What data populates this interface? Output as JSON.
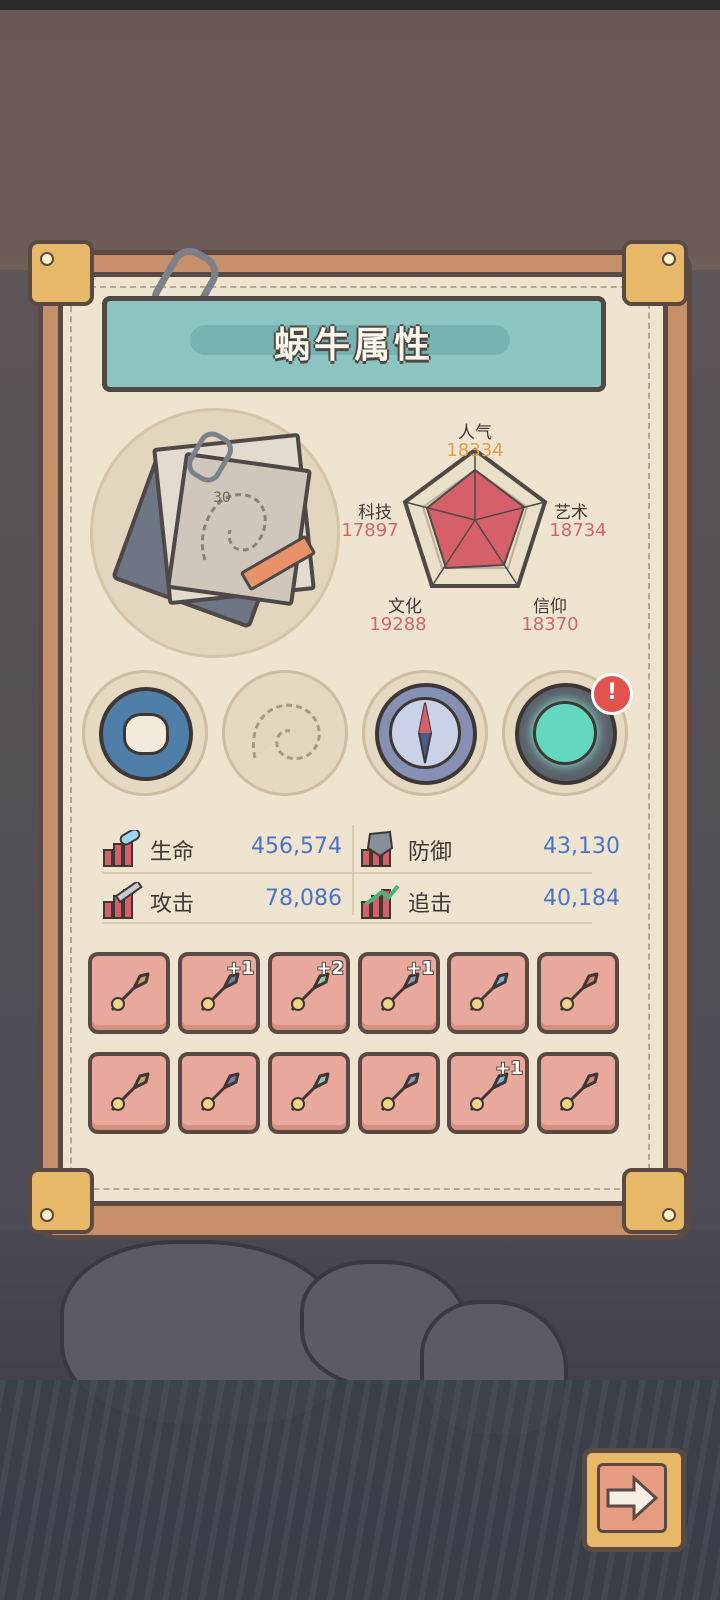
{
  "panel": {
    "title": "蜗牛属性"
  },
  "radar": {
    "stats": [
      {
        "name": "人气",
        "value": "18334"
      },
      {
        "name": "艺术",
        "value": "18734"
      },
      {
        "name": "信仰",
        "value": "18370"
      },
      {
        "name": "文化",
        "value": "19288"
      },
      {
        "name": "科技",
        "value": "17897"
      }
    ]
  },
  "medallions": [
    {
      "icon": "chomper-fish-icon",
      "notify": false
    },
    {
      "icon": "snail-shell-icon",
      "notify": false
    },
    {
      "icon": "compass-icon",
      "notify": false
    },
    {
      "icon": "portal-orb-icon",
      "notify": true,
      "badge": "!"
    }
  ],
  "attributes": [
    {
      "label": "生命",
      "value": "456,574",
      "icon": "health-icon"
    },
    {
      "label": "防御",
      "value": "43,130",
      "icon": "defense-icon"
    },
    {
      "label": "攻击",
      "value": "78,086",
      "icon": "attack-icon"
    },
    {
      "label": "追击",
      "value": "40,184",
      "icon": "pursuit-icon"
    }
  ],
  "equipment": [
    {
      "icon": "mace-icon",
      "plus": ""
    },
    {
      "icon": "crossbow-icon",
      "plus": "+1"
    },
    {
      "icon": "serpent-staff-icon",
      "plus": "+2"
    },
    {
      "icon": "axe-icon",
      "plus": "+1"
    },
    {
      "icon": "blue-sword-icon",
      "plus": ""
    },
    {
      "icon": "rocket-blade-icon",
      "plus": ""
    },
    {
      "icon": "cloak-icon",
      "plus": ""
    },
    {
      "icon": "hook-icon",
      "plus": ""
    },
    {
      "icon": "spear-icon",
      "plus": ""
    },
    {
      "icon": "armor-icon",
      "plus": ""
    },
    {
      "icon": "dagger-icon",
      "plus": "+1"
    },
    {
      "icon": "helmet-icon",
      "plus": ""
    }
  ],
  "colors": {
    "value_blue": "#4a74c9",
    "stat_red": "#d66567",
    "title_teal": "#8cc4c2",
    "slot_pink": "#e8a99c"
  }
}
